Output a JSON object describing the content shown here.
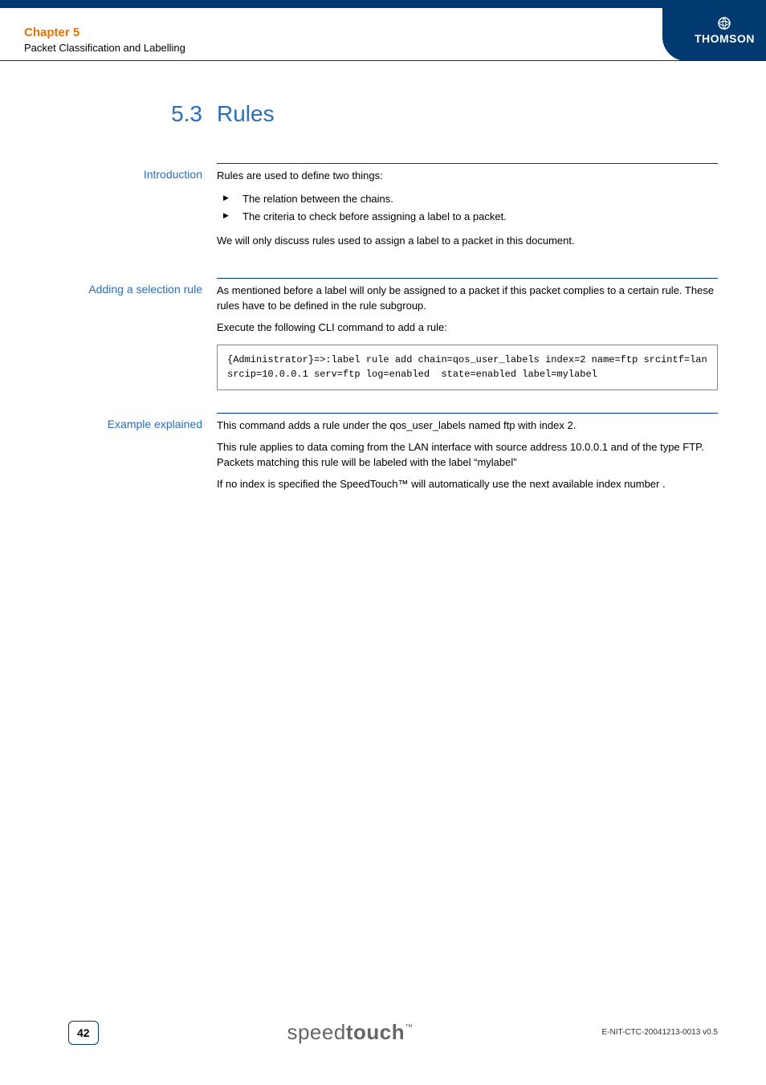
{
  "header": {
    "chapter": "Chapter 5",
    "subtitle": "Packet Classification and Labelling",
    "brand": "THOMSON"
  },
  "title": {
    "number": "5.3",
    "text": "Rules"
  },
  "sections": {
    "intro": {
      "label": "Introduction",
      "p1": "Rules are used to define two things:",
      "bullets": [
        "The relation between the chains.",
        "The criteria to check before assigning a label to a packet."
      ],
      "p2": "We will only discuss rules used to assign a label to a packet in this document."
    },
    "adding": {
      "label": "Adding a selection rule",
      "p1": "As mentioned before a label will only be assigned to a packet if this packet complies to a certain rule. These rules have to be defined in the rule subgroup.",
      "p2": "Execute the following CLI command to add a rule:",
      "code": "{Administrator}=>:label rule add chain=qos_user_labels index=2 name=ftp srcintf=lan srcip=10.0.0.1 serv=ftp log=enabled  state=enabled label=mylabel"
    },
    "example": {
      "label": "Example explained",
      "p1": "This command adds a rule under the qos_user_labels named ftp with index 2.",
      "p2": "This rule applies to data coming from the LAN interface with source address 10.0.0.1 and of the type FTP. Packets matching this rule will be labeled with the label “mylabel”",
      "p3": "If no index is specified the SpeedTouch™ will automatically use the next available index number ."
    }
  },
  "footer": {
    "page": "42",
    "logo_thin": "speed",
    "logo_bold": "touch",
    "logo_tm": "™",
    "docid": "E-NIT-CTC-20041213-0013 v0.5"
  }
}
